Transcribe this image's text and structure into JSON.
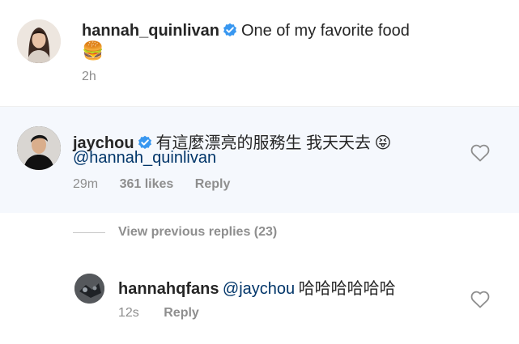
{
  "post": {
    "username": "hannah_quinlivan",
    "caption": "One of my favorite food",
    "emoji": "🍔",
    "time": "2h"
  },
  "comment": {
    "username": "jaychou",
    "text": "有這麼漂亮的服務生 我天天去",
    "emoji": "😝",
    "mention": "@hannah_quinlivan",
    "time": "29m",
    "likes": "361 likes",
    "reply_label": "Reply"
  },
  "view_replies": "View previous replies (23)",
  "reply": {
    "username": "hannahqfans",
    "mention": "@jaychou",
    "text": "哈哈哈哈哈哈",
    "time": "12s",
    "reply_label": "Reply"
  },
  "colors": {
    "highlight_bg": "#f5f8fd",
    "verified": "#3897f0",
    "mention": "#003569",
    "meta": "#8e8e8e"
  }
}
